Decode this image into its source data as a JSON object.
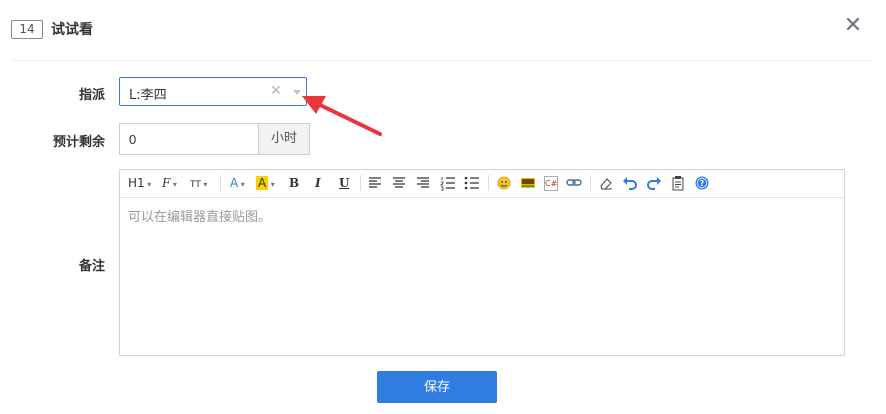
{
  "header": {
    "id_badge": "14",
    "title": "试试看"
  },
  "form": {
    "assign_label": "指派",
    "assign_value": "L:李四",
    "remaining_label": "预计剩余",
    "remaining_value": "0",
    "remaining_unit": "小时",
    "note_label": "备注",
    "editor_placeholder": "可以在编辑器直接贴图。"
  },
  "toolbar": {
    "heading": "H1",
    "font_family": "F",
    "font_size": "TT",
    "font_color": "A",
    "highlight": "A",
    "bold": "B",
    "italic": "I",
    "underline": "U",
    "code": "C#"
  },
  "actions": {
    "save_label": "保存"
  },
  "colors": {
    "primary": "#2f7de1",
    "arrow": "#e8363c",
    "highlight": "#f7d200"
  }
}
